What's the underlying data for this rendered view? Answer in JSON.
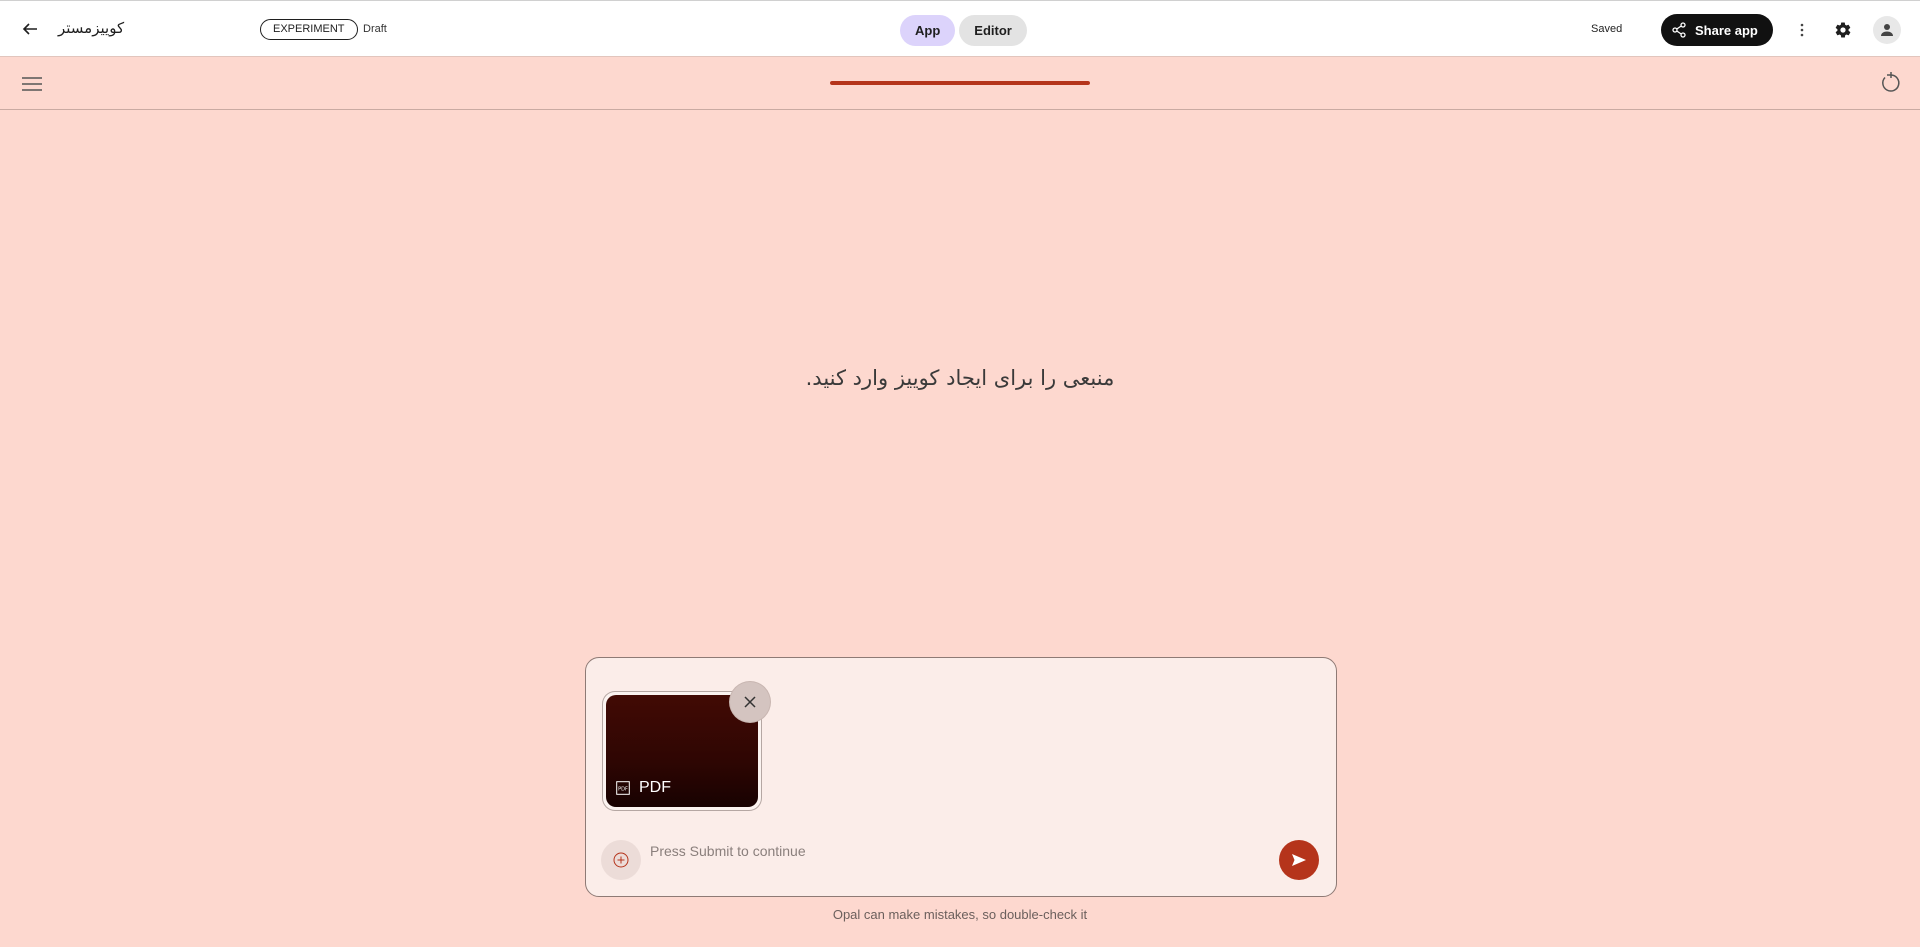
{
  "header": {
    "app_title": "کوییزمستر",
    "badge": "EXPERIMENT",
    "status": "Draft",
    "tabs": [
      {
        "label": "App",
        "active": true
      },
      {
        "label": "Editor",
        "active": false
      }
    ],
    "saved_label": "Saved",
    "share_label": "Share app",
    "icons": [
      "arrow-back-icon",
      "share-icon",
      "more-vert-icon",
      "gear-icon",
      "account-icon"
    ]
  },
  "subbar": {
    "progress": 1.0,
    "icons": [
      "menu-icon",
      "refresh-icon"
    ]
  },
  "main": {
    "prompt": "منبعی را برای ایجاد کوییز وارد کنید."
  },
  "composer": {
    "attachment_type": "PDF",
    "placeholder": "Press Submit to continue",
    "value": "",
    "icons": [
      "pdf-file-icon",
      "close-icon",
      "add-circle-icon",
      "send-icon"
    ]
  },
  "footer": {
    "disclaimer": "Opal can make mistakes, so double-check it"
  },
  "colors": {
    "background": "#fdd8cf",
    "accent": "#b5341b",
    "app_tab": "#dcd3fb",
    "share_button": "#111111"
  }
}
